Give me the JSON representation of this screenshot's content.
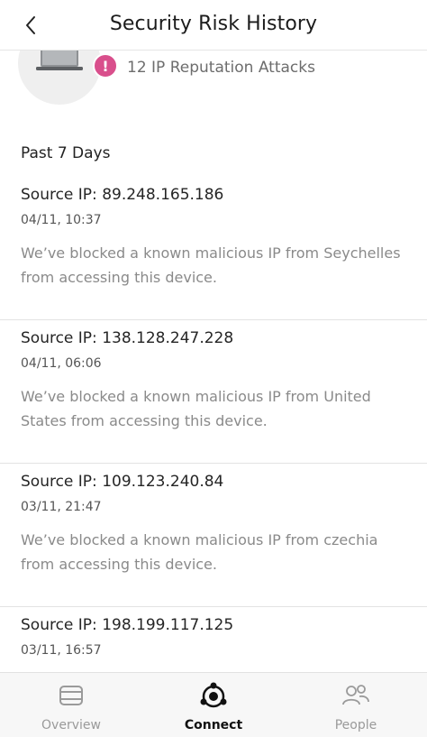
{
  "header": {
    "title": "Security Risk History"
  },
  "summary": {
    "attacks_text": "12 IP Reputation Attacks",
    "badge": "!"
  },
  "period_label": "Past 7 Days",
  "events": [
    {
      "ip": "Source IP: 89.248.165.186",
      "time": "04/11, 10:37",
      "message": "We’ve blocked a known malicious IP from Seychelles from accessing this device."
    },
    {
      "ip": "Source IP: 138.128.247.228",
      "time": "04/11, 06:06",
      "message": "We’ve blocked a known malicious IP from United States from accessing this device."
    },
    {
      "ip": "Source IP: 109.123.240.84",
      "time": "03/11, 21:47",
      "message": "We’ve blocked a known malicious IP from czechia from accessing this device."
    },
    {
      "ip": "Source IP: 198.199.117.125",
      "time": "03/11, 16:57",
      "message": ""
    }
  ],
  "nav": {
    "items": [
      {
        "label": "Overview",
        "icon": "overview-icon",
        "active": false
      },
      {
        "label": "Connect",
        "icon": "connect-icon",
        "active": true
      },
      {
        "label": "People",
        "icon": "people-icon",
        "active": false
      }
    ]
  },
  "colors": {
    "alert": "#d94f8c",
    "muted_text": "#8a8a8a",
    "nav_bg": "#f7f7f7"
  }
}
